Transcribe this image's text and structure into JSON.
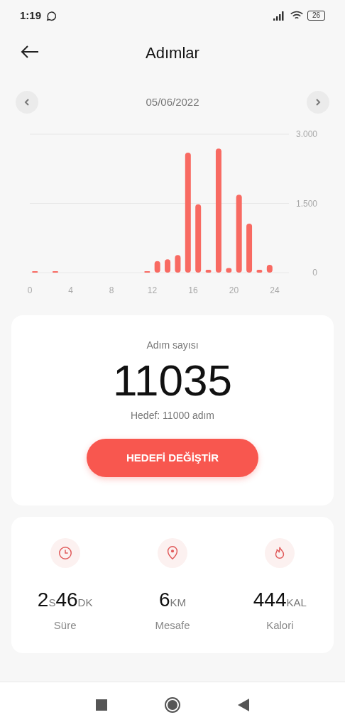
{
  "status_bar": {
    "time": "1:19",
    "battery": "26"
  },
  "header": {
    "title": "Adımlar"
  },
  "date_nav": {
    "date": "05/06/2022"
  },
  "chart": {
    "chart_data": {
      "type": "bar",
      "x": [
        0.5,
        1.5,
        2.5,
        3.5,
        4.5,
        5.5,
        6.5,
        7.5,
        8.5,
        9.5,
        10.5,
        11.5,
        12.5,
        13.5,
        14.5,
        15.5,
        16.5,
        17.5,
        18.5,
        19.5,
        20.5,
        21.5,
        22.5,
        23.5
      ],
      "xlim": [
        0,
        24
      ],
      "series": [
        {
          "color": "#f86a62",
          "values": [
            20,
            0,
            10,
            0,
            0,
            0,
            0,
            0,
            0,
            0,
            0,
            10,
            250,
            290,
            380,
            2600,
            1480,
            60,
            2690,
            100,
            1690,
            1060,
            60,
            170
          ]
        }
      ],
      "ylim": [
        0,
        3000
      ],
      "yticks": [
        {
          "value": 0,
          "label": "0"
        },
        {
          "value": 1500,
          "label": "1.500"
        },
        {
          "value": 3000,
          "label": "3.000"
        }
      ],
      "xticks": [
        0,
        4,
        8,
        12,
        16,
        20,
        24
      ]
    }
  },
  "summary": {
    "label": "Adım sayısı",
    "count": "11035",
    "goal": "Hedef: 11000 adım",
    "button": "HEDEFİ DEĞİŞTİR"
  },
  "stats": [
    {
      "kind": "time",
      "parts": [
        {
          "text": "2",
          "unit": false
        },
        {
          "text": "S",
          "unit": true
        },
        {
          "text": "46",
          "unit": false
        },
        {
          "text": "DK",
          "unit": true
        }
      ],
      "label": "Süre"
    },
    {
      "kind": "distance",
      "parts": [
        {
          "text": "6",
          "unit": false
        },
        {
          "text": "KM",
          "unit": true
        }
      ],
      "label": "Mesafe"
    },
    {
      "kind": "calories",
      "parts": [
        {
          "text": "444",
          "unit": false
        },
        {
          "text": "KAL",
          "unit": true
        }
      ],
      "label": "Kalori"
    }
  ]
}
